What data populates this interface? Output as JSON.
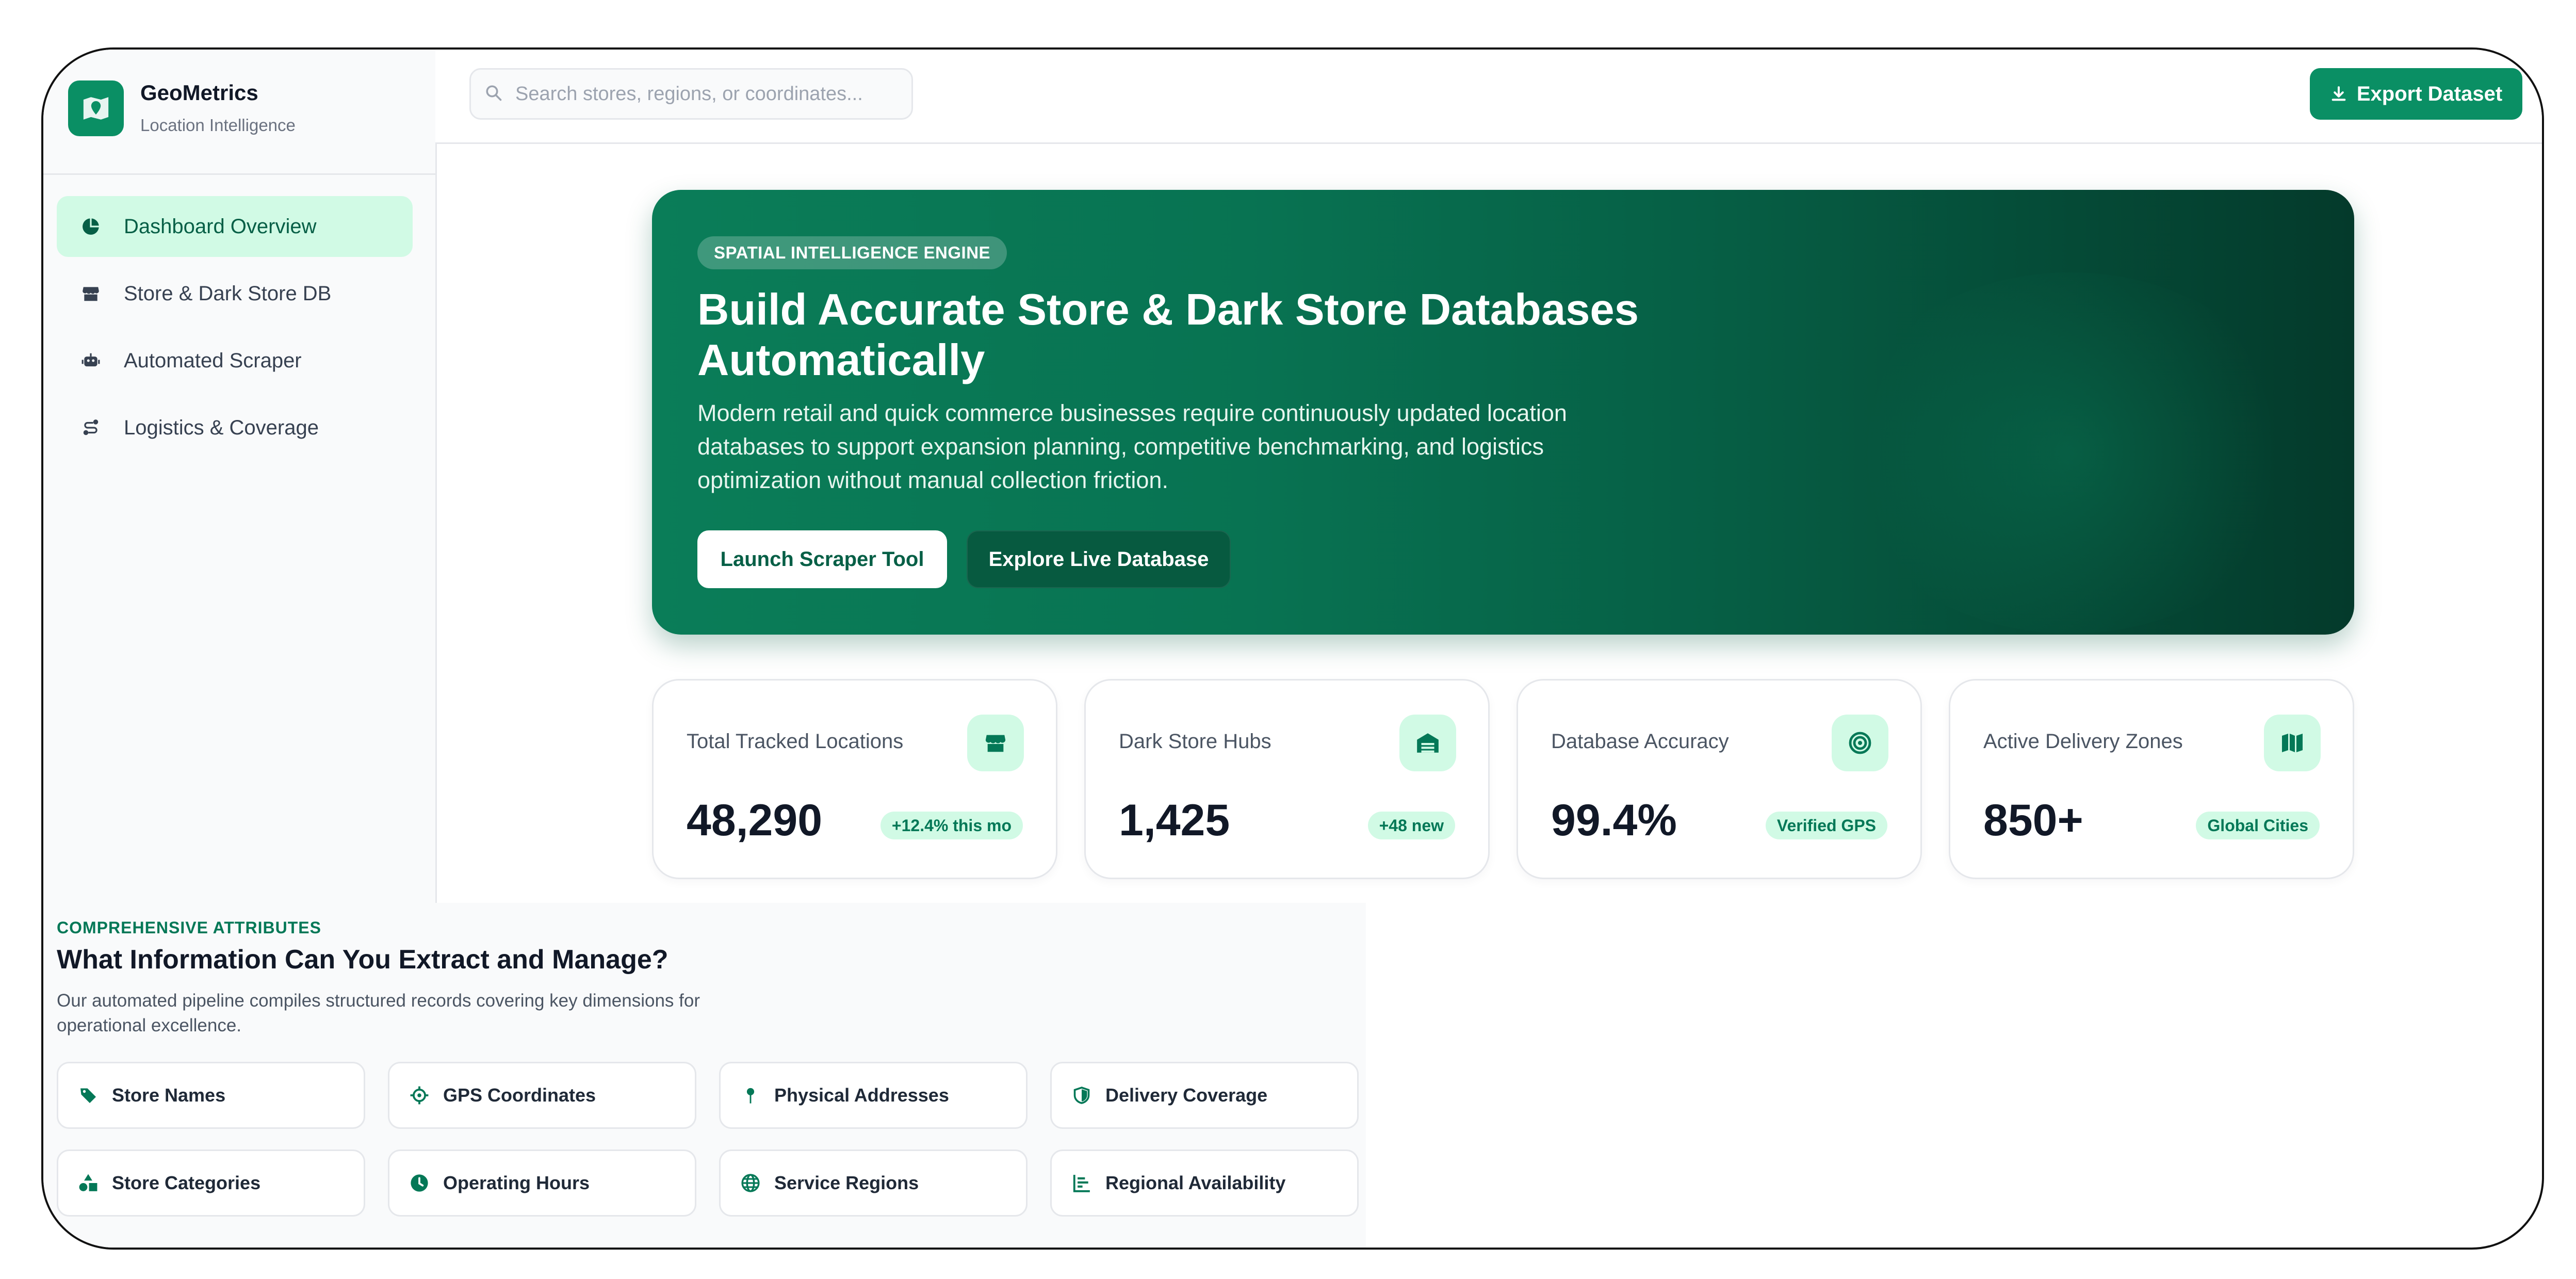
{
  "brand": {
    "name": "GeoMetrics",
    "tagline": "Location Intelligence",
    "icon": "map-pin-icon"
  },
  "sidebar": {
    "items": [
      {
        "label": "Dashboard Overview",
        "icon": "chart-pie-icon",
        "active": true
      },
      {
        "label": "Store & Dark Store DB",
        "icon": "store-icon",
        "active": false
      },
      {
        "label": "Automated Scraper",
        "icon": "robot-icon",
        "active": false
      },
      {
        "label": "Logistics & Coverage",
        "icon": "route-icon",
        "active": false
      }
    ]
  },
  "topbar": {
    "search_placeholder": "Search stores, regions, or coordinates...",
    "search_value": "",
    "export_label": "Export Dataset",
    "export_icon": "download-icon"
  },
  "hero": {
    "tag": "SPATIAL INTELLIGENCE ENGINE",
    "title": "Build Accurate Store & Dark Store Databases Automatically",
    "description": "Modern retail and quick commerce businesses require continuously updated location databases to support expansion planning, competitive benchmarking, and logistics optimization without manual collection friction.",
    "primary_button": "Launch Scraper Tool",
    "secondary_button": "Explore Live Database"
  },
  "stats": [
    {
      "label": "Total Tracked Locations",
      "value": "48,290",
      "badge": "+12.4% this mo",
      "icon": "store-icon"
    },
    {
      "label": "Dark Store Hubs",
      "value": "1,425",
      "badge": "+48 new",
      "icon": "warehouse-icon"
    },
    {
      "label": "Database Accuracy",
      "value": "99.4%",
      "badge": "Verified GPS",
      "icon": "target-icon"
    },
    {
      "label": "Active Delivery Zones",
      "value": "850+",
      "badge": "Global Cities",
      "icon": "map-icon"
    }
  ],
  "attributes": {
    "eyebrow": "COMPREHENSIVE ATTRIBUTES",
    "title": "What Information Can You Extract and Manage?",
    "description": "Our automated pipeline compiles structured records covering key dimensions for operational excellence.",
    "items": [
      {
        "label": "Store Names",
        "icon": "tag-icon"
      },
      {
        "label": "GPS Coordinates",
        "icon": "crosshair-icon"
      },
      {
        "label": "Physical Addresses",
        "icon": "map-pin-icon"
      },
      {
        "label": "Delivery Coverage",
        "icon": "shield-icon"
      },
      {
        "label": "Store Categories",
        "icon": "shapes-icon"
      },
      {
        "label": "Operating Hours",
        "icon": "clock-icon"
      },
      {
        "label": "Service Regions",
        "icon": "globe-icon"
      },
      {
        "label": "Regional Availability",
        "icon": "bar-chart-icon"
      }
    ]
  },
  "colors": {
    "accent": "#0a8f64",
    "accent_light": "#d1fae5",
    "accent_dark": "#065f46"
  }
}
